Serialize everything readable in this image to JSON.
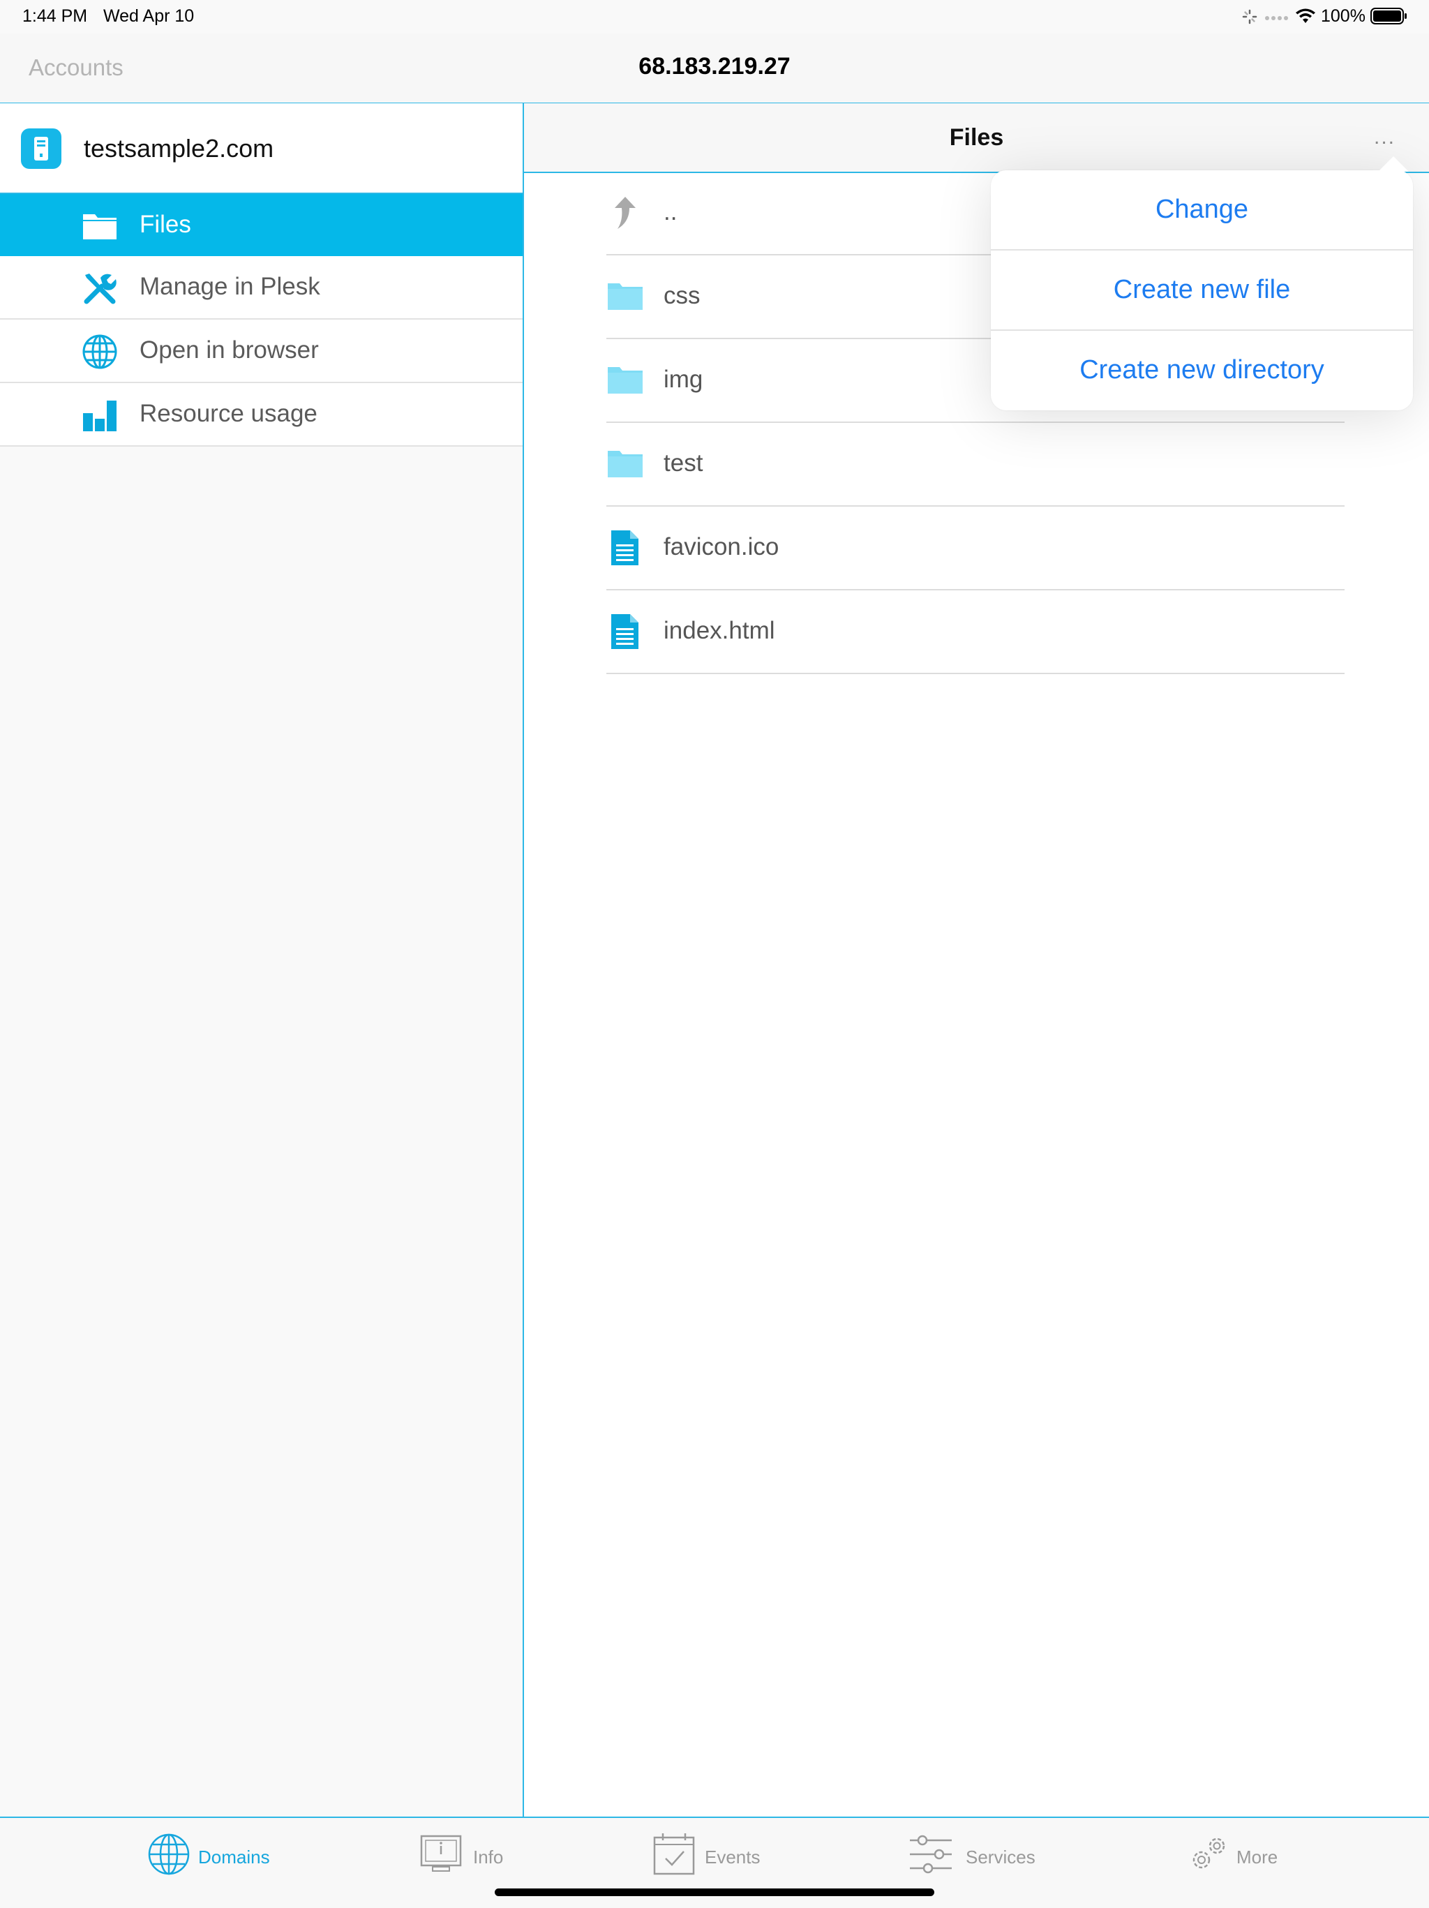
{
  "status_bar": {
    "time": "1:44 PM",
    "date": "Wed Apr 10",
    "battery": "100%"
  },
  "nav": {
    "back_label": "Accounts",
    "title": "68.183.219.27"
  },
  "sidebar": {
    "domain": "testsample2.com",
    "items": [
      {
        "label": "Files",
        "icon": "folder-icon",
        "selected": true
      },
      {
        "label": "Manage in Plesk",
        "icon": "tools-icon"
      },
      {
        "label": "Open in browser",
        "icon": "globe-icon"
      },
      {
        "label": "Resource usage",
        "icon": "bar-chart-icon"
      }
    ]
  },
  "main": {
    "title": "Files",
    "more_label": "...",
    "files": [
      {
        "name": "..",
        "icon": "up-arrow-icon"
      },
      {
        "name": "css",
        "icon": "folder-icon"
      },
      {
        "name": "img",
        "icon": "folder-icon"
      },
      {
        "name": "test",
        "icon": "folder-icon"
      },
      {
        "name": "favicon.ico",
        "icon": "document-icon"
      },
      {
        "name": "index.html",
        "icon": "document-icon"
      }
    ]
  },
  "popover": {
    "items": [
      "Change",
      "Create new file",
      "Create new directory"
    ]
  },
  "tabbar": {
    "tabs": [
      {
        "label": "Domains",
        "icon": "globe-icon",
        "active": true
      },
      {
        "label": "Info",
        "icon": "monitor-icon"
      },
      {
        "label": "Events",
        "icon": "calendar-check-icon"
      },
      {
        "label": "Services",
        "icon": "sliders-icon"
      },
      {
        "label": "More",
        "icon": "gears-icon"
      }
    ]
  },
  "colors": {
    "accent": "#05b8e9",
    "link": "#1d7cf0",
    "divider": "#2db8e6"
  }
}
